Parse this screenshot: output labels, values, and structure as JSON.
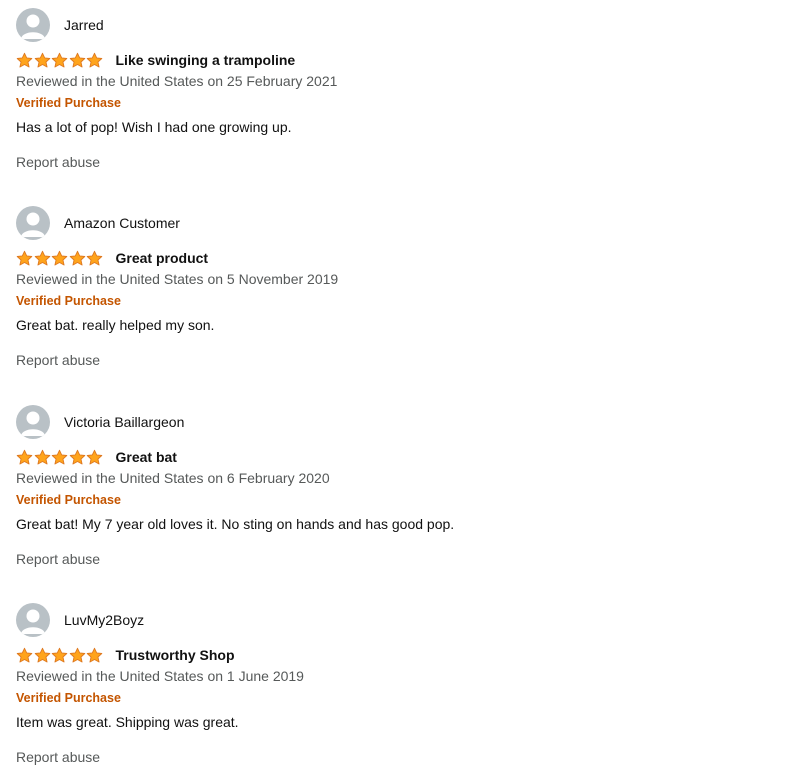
{
  "colors": {
    "star": "#ffa41c",
    "verified": "#c45500",
    "muted": "#565959",
    "avatar": "#b9c1c6"
  },
  "reviews": [
    {
      "profile_name": "Jarred",
      "rating": 5,
      "title": "Like swinging a trampoline",
      "date": "Reviewed in the United States on 25 February 2021",
      "verified": "Verified Purchase",
      "body": "Has a lot of pop! Wish I had one growing up.",
      "report": "Report abuse"
    },
    {
      "profile_name": "Amazon Customer",
      "rating": 5,
      "title": "Great product",
      "date": "Reviewed in the United States on 5 November 2019",
      "verified": "Verified Purchase",
      "body": "Great bat. really helped my son.",
      "report": "Report abuse"
    },
    {
      "profile_name": "Victoria Baillargeon",
      "rating": 5,
      "title": "Great bat",
      "date": "Reviewed in the United States on 6 February 2020",
      "verified": "Verified Purchase",
      "body": "Great bat! My 7 year old loves it. No sting on hands and has good pop.",
      "report": "Report abuse"
    },
    {
      "profile_name": "LuvMy2Boyz",
      "rating": 5,
      "title": "Trustworthy Shop",
      "date": "Reviewed in the United States on 1 June 2019",
      "verified": "Verified Purchase",
      "body": "Item was great. Shipping was great.",
      "report": "Report abuse"
    }
  ]
}
